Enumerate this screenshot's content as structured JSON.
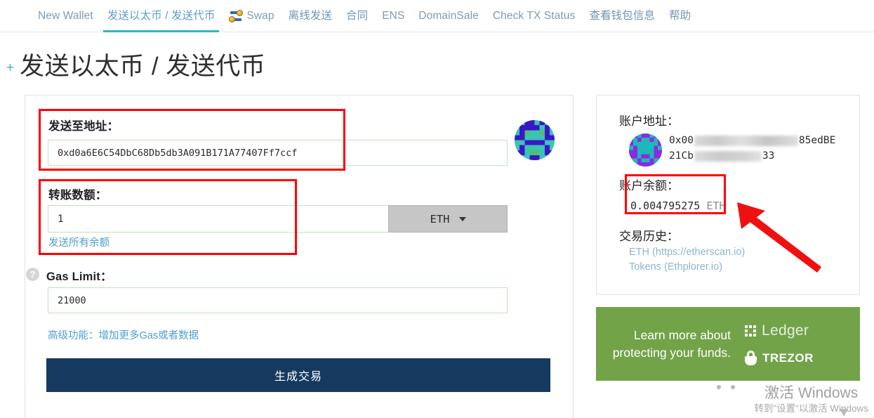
{
  "nav": {
    "items": [
      {
        "label": "New Wallet",
        "active": false,
        "icon": null
      },
      {
        "label": "发送以太币 / 发送代币",
        "active": true,
        "icon": null
      },
      {
        "label": "Swap",
        "active": false,
        "icon": "swap-icon"
      },
      {
        "label": "离线发送",
        "active": false,
        "icon": null
      },
      {
        "label": "合同",
        "active": false,
        "icon": null
      },
      {
        "label": "ENS",
        "active": false,
        "icon": null
      },
      {
        "label": "DomainSale",
        "active": false,
        "icon": null
      },
      {
        "label": "Check TX Status",
        "active": false,
        "icon": null
      },
      {
        "label": "查看钱包信息",
        "active": false,
        "icon": null
      },
      {
        "label": "帮助",
        "active": false,
        "icon": null
      }
    ],
    "active_underline_color": "#2fb8c6"
  },
  "header": {
    "plus": "+",
    "title": "发送以太币 / 发送代币"
  },
  "form": {
    "to_address": {
      "label": "发送至地址：",
      "value": "0xd0a6E6C54DbC68Db5db3A091B171A77407Ff7ccf",
      "placeholder": "0x"
    },
    "amount": {
      "label": "转账数额：",
      "value": "1",
      "placeholder": "",
      "unit": "ETH",
      "send_all_link": "发送所有余额"
    },
    "gas_limit": {
      "label": "Gas Limit：",
      "help_icon": "question-mark-icon",
      "value": "21000",
      "placeholder": ""
    },
    "advanced_link": "高级功能：增加更多Gas或者数据",
    "submit_button": "生成交易"
  },
  "sidebar": {
    "account_address": {
      "label": "账户地址：",
      "line1_prefix": "0x00",
      "line1_suffix": "85edBE",
      "line2_prefix": "21Cb",
      "line2_suffix": "33",
      "redacted": true
    },
    "balance": {
      "label": "账户余额：",
      "amount": "0.004795275",
      "unit": "ETH"
    },
    "history": {
      "label": "交易历史：",
      "links": [
        "ETH (https://etherscan.io)",
        "Tokens (Ethplorer.io)"
      ]
    }
  },
  "promo": {
    "text": "Learn more about protecting your funds.",
    "background_color": "#72a349",
    "brands": [
      {
        "name": "Ledger",
        "icon": "ledger-logo-icon"
      },
      {
        "name": "TREZOR",
        "icon": "trezor-lock-icon"
      }
    ]
  },
  "annotations": {
    "highlight_color": "#ff0000",
    "arrow": "red-arrow-pointing-to-balance"
  },
  "watermark": {
    "line1": "激活 Windows",
    "line2": "转到\"设置\"以激活 Windows"
  }
}
